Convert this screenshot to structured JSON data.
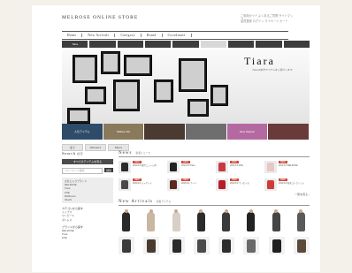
{
  "header": {
    "store_title": "MELROSE ONLINE STORE",
    "right_links_1": "ご利用ガイド  よくあるご質問  サイトマップ",
    "right_links_2": "会員登録  ログイン  マイページ  カート"
  },
  "global_nav": [
    "Home",
    "New Arrivals",
    "Category",
    "Brand",
    "Coordinate"
  ],
  "brand_tabs": [
    {
      "label": "Tiara",
      "light": false
    },
    {
      "label": "",
      "light": false
    },
    {
      "label": "",
      "light": false
    },
    {
      "label": "",
      "light": false
    },
    {
      "label": "",
      "light": false
    },
    {
      "label": "",
      "light": true
    },
    {
      "label": "",
      "light": false
    },
    {
      "label": "",
      "light": false
    },
    {
      "label": "",
      "light": false
    }
  ],
  "hero": {
    "brand": "Tiara",
    "tagline": "Tiaraの新作アイテムをご紹介します。"
  },
  "thumbs": [
    {
      "label": "人気アイテム",
      "color": "#2e4b6a"
    },
    {
      "label": "Military Mix",
      "color": "#8a7a5c"
    },
    {
      "label": "",
      "color": "#4a3a32"
    },
    {
      "label": "",
      "color": "#6e6e6e"
    },
    {
      "label": "New Season",
      "color": "#b46aa0"
    },
    {
      "label": "",
      "color": "#6a3a3a"
    }
  ],
  "selector_tabs": [
    "全て",
    "Women's",
    "Men's"
  ],
  "sidebar": {
    "search_heading": "Search",
    "search_sub": "検索",
    "dark_button": "すべてのアイテムを見る",
    "search_placeholder": "フリーワード検索",
    "search_button": "検索",
    "box_items": [
      "お気に入りブランド",
      "MELROSE",
      "Tiara",
      "ZOE",
      "MARcourt",
      "SILAS"
    ],
    "cap1": "カテゴリから探す",
    "list1": [
      "トップス",
      "ワンピース",
      "ボトムス"
    ],
    "cap2": "ブランドから探す",
    "list2": [
      "MELROSE",
      "Tiara",
      "ZOE"
    ]
  },
  "news": {
    "title": "News",
    "sub": "新着ニュース",
    "items": [
      {
        "badge": "NEW",
        "text": "2010.9.5 新作ニット入荷",
        "color": "#2b2b2b"
      },
      {
        "badge": "NEW",
        "text": "2010.9.5 Tiara",
        "color": "#222222"
      },
      {
        "badge": "NEW",
        "text": "2010.9.5 ZOE",
        "color": "#c73a42"
      },
      {
        "badge": "NEW",
        "text": "2010.9.5 MELROSE",
        "color": "#e7c8c4"
      },
      {
        "badge": "NEW",
        "text": "2010.9.4 ジャケット",
        "color": "#4a4a4a"
      },
      {
        "badge": "NEW",
        "text": "2010.9.4 ブーツ",
        "color": "#5a2a1e"
      },
      {
        "badge": "NEW",
        "text": "2010.9.4 ワンピース",
        "color": "#b51e2a"
      },
      {
        "badge": "NEW",
        "text": "2010.9.4 秋冬コレクション",
        "color": "#d23a3a"
      }
    ],
    "more": "一覧を見る ›"
  },
  "arrivals": {
    "title": "New Arrivals",
    "sub": "新着アイテム",
    "row1": [
      "#2a2a2a",
      "#c9b7a3",
      "#d6d0c6",
      "#2b2b2b",
      "#3a3a3a",
      "#222222",
      "#454545",
      "#5a5a5a"
    ],
    "row2": [
      "#3a3a3a",
      "#4a3a2e",
      "#2a2a2a",
      "#4b4b4b",
      "#2e2e2e",
      "#6a6a6a",
      "#1f1f1f",
      "#5b4a3a"
    ]
  }
}
